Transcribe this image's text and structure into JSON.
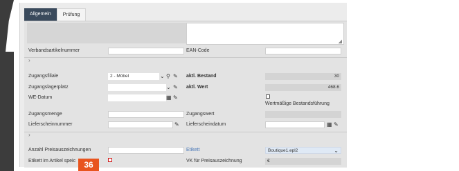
{
  "tabs": [
    "Allgemein",
    "Prüfung"
  ],
  "fields": {
    "verbandsartikelnummer": "Verbandsartikelnummer",
    "ean_code": "EAN-Code",
    "zugangsfiliale": "Zugangsfiliale",
    "zugangsfiliale_value": "2 - Möbel",
    "aktl_bestand": "aktl. Bestand",
    "aktl_bestand_value": "30",
    "zugangslagerplatz": "Zugangslagerplatz",
    "aktl_wert": "aktl. Wert",
    "aktl_wert_value": "468.6",
    "we_datum": "WE-Datum",
    "wertmaessige": "Wertmäßige Bestandsführung",
    "zugangsmenge": "Zugangsmenge",
    "zugangswert": "Zugangswert",
    "lieferscheinnummer": "Lieferscheinnummer",
    "lieferscheindatum": "Lieferscheindatum",
    "anzahl_preisauszeichnungen": "Anzahl Preisauszeichnungen",
    "etikett": "Etikett",
    "etikett_value": "Boutique1.epl2",
    "etikett_im_artikel": "Etikett im Artikel speic",
    "vk_preisauszeichnung": "VK für Preisauszeichnung",
    "vk_value": "€"
  },
  "badge": "36",
  "icons": {
    "chevron": "chevron-down-icon",
    "search": "search-icon",
    "broom": "clear-icon",
    "calendar": "calendar-icon",
    "expand": "expand-arrow-icon"
  },
  "colors": {
    "tab_active": "#3a4a5c",
    "badge": "#e8541e",
    "checkbox_highlight": "#d21f1f",
    "etikett_label": "#4a78b8"
  }
}
